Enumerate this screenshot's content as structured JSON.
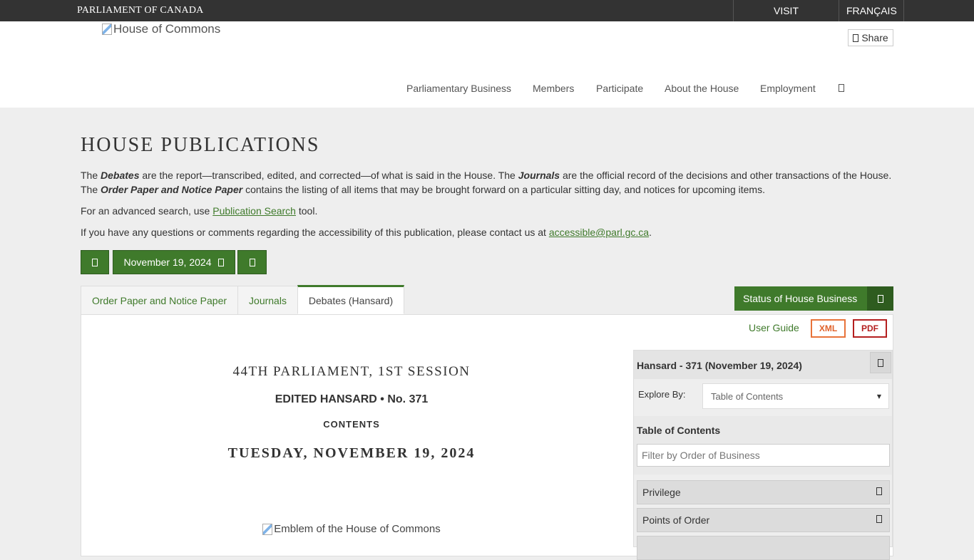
{
  "topbar": {
    "brand": "PARLIAMENT OF CANADA",
    "visit": "VISIT PARLIAMENT",
    "language": "FRANÇAIS"
  },
  "header": {
    "logo_alt": "House of Commons",
    "share_label": "Share",
    "share_icon": "share-icon",
    "nav": [
      "Parliamentary Business",
      "Members",
      "Participate",
      "About the House",
      "Employment"
    ],
    "search_icon": "search-icon"
  },
  "main": {
    "title": "HOUSE PUBLICATIONS",
    "intro_line1": {
      "t1": "The ",
      "b1": "Debates",
      "t2": " are the report—transcribed, edited, and corrected—of what is said in the House. The ",
      "b2": "Journals",
      "t3": " are the official record of the decisions and other transactions of the House."
    },
    "intro_line2": {
      "t1": "The ",
      "b1": "Order Paper and Notice Paper",
      "t2": " contains the listing of all items that may be brought forward on a particular sitting day, and notices for upcoming items."
    },
    "search_line": {
      "t1": "For an advanced search, use ",
      "link": "Publication Search",
      "t2": " tool."
    },
    "contact_line": {
      "t1": "If you have any questions or comments regarding the accessibility of this publication, please contact us at ",
      "link": "accessible@parl.gc.ca",
      "t2": "."
    },
    "date_nav": {
      "prev_icon": "chevron-left-icon",
      "date": "November 19, 2024",
      "calendar_icon": "calendar-icon",
      "next_icon": "chevron-right-icon"
    },
    "tabs": [
      {
        "label": "Order Paper and Notice Paper",
        "active": false
      },
      {
        "label": "Journals",
        "active": false
      },
      {
        "label": "Debates (Hansard)",
        "active": true
      }
    ],
    "status_button": "Status of House Business",
    "tools": {
      "user_guide": "User Guide",
      "xml": "XML",
      "pdf": "PDF"
    },
    "document": {
      "session": "44TH PARLIAMENT, 1ST SESSION",
      "hansard_no": "EDITED HANSARD • No. 371",
      "contents": "CONTENTS",
      "date": "TUESDAY, NOVEMBER 19, 2024",
      "emblem_alt": "Emblem of the House of Commons"
    },
    "toc": {
      "title": "Hansard - 371 (November 19, 2024)",
      "explore_label": "Explore By:",
      "explore_value": "Table of Contents",
      "section_title": "Table of Contents",
      "filter_placeholder": "Filter by Order of Business",
      "items": [
        "Privilege",
        "Points of Order"
      ]
    }
  },
  "colors": {
    "primary_green": "#3f7a2b",
    "topbar": "#333333",
    "xml_orange": "#e8733a",
    "pdf_red": "#b41f1f"
  }
}
